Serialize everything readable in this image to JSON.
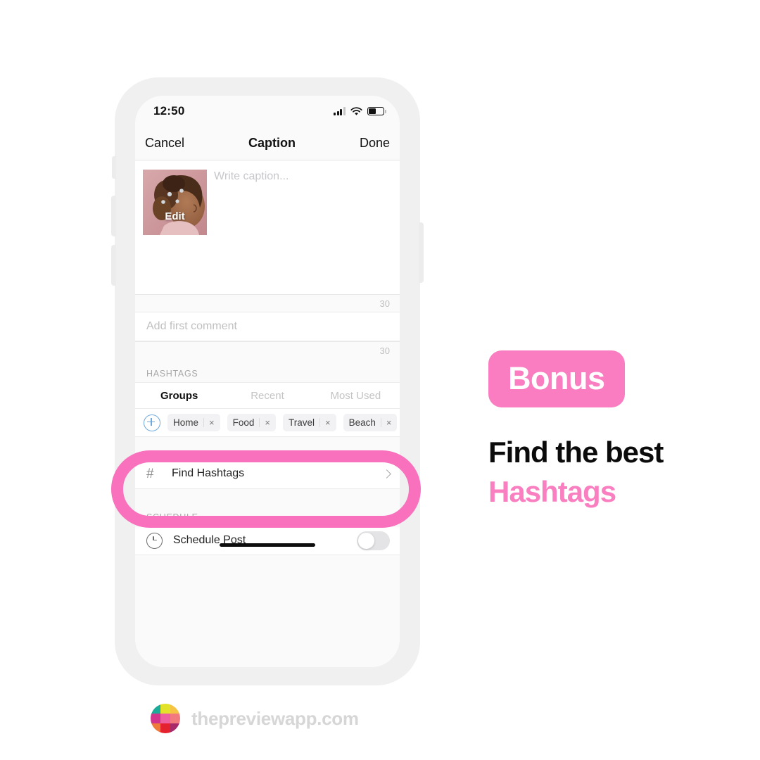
{
  "phone": {
    "status_bar": {
      "time": "12:50",
      "signal_icon": "cellular-signal-icon",
      "wifi_icon": "wifi-icon",
      "battery_icon": "battery-icon"
    },
    "nav_bar": {
      "cancel_label": "Cancel",
      "title": "Caption",
      "done_label": "Done"
    },
    "caption": {
      "thumb_edit_label": "Edit",
      "placeholder": "Write caption...",
      "counter": "30"
    },
    "comment": {
      "placeholder": "Add first comment",
      "counter": "30"
    },
    "hashtags": {
      "section_label": "HASHTAGS",
      "tabs": [
        {
          "label": "Groups",
          "active": true
        },
        {
          "label": "Recent",
          "active": false
        },
        {
          "label": "Most Used",
          "active": false
        }
      ],
      "add_group_icon": "plus-circle-icon",
      "chips": [
        {
          "label": "Home",
          "remove_icon": "×"
        },
        {
          "label": "Food",
          "remove_icon": "×"
        },
        {
          "label": "Travel",
          "remove_icon": "×"
        },
        {
          "label": "Beach",
          "remove_icon": "×"
        }
      ]
    },
    "find_hashtags": {
      "icon": "#",
      "label": "Find Hashtags",
      "chevron_icon": "chevron-right-icon"
    },
    "schedule": {
      "section_label": "SCHEDULE",
      "clock_icon": "clock-icon",
      "label": "Schedule Post",
      "toggle_state": "off"
    }
  },
  "right_panel": {
    "badge_label": "Bonus",
    "headline_line1": "Find the best",
    "headline_line2": "Hashtags"
  },
  "footer": {
    "brand": "thepreviewapp.com",
    "logo_icon": "preview-grid-logo-icon",
    "logo_colors": [
      "#1aab9b",
      "#e3e22a",
      "#f6c445",
      "#d1338d",
      "#ee5fa0",
      "#f27a7e",
      "#ef7b3a",
      "#e4222f",
      "#a82a6a"
    ]
  },
  "colors": {
    "accent_pink": "#f97dc0",
    "highlight_ring": "#f970bd",
    "headline_pink": "#fa7fc1",
    "footer_gray": "#d6d6d6"
  }
}
